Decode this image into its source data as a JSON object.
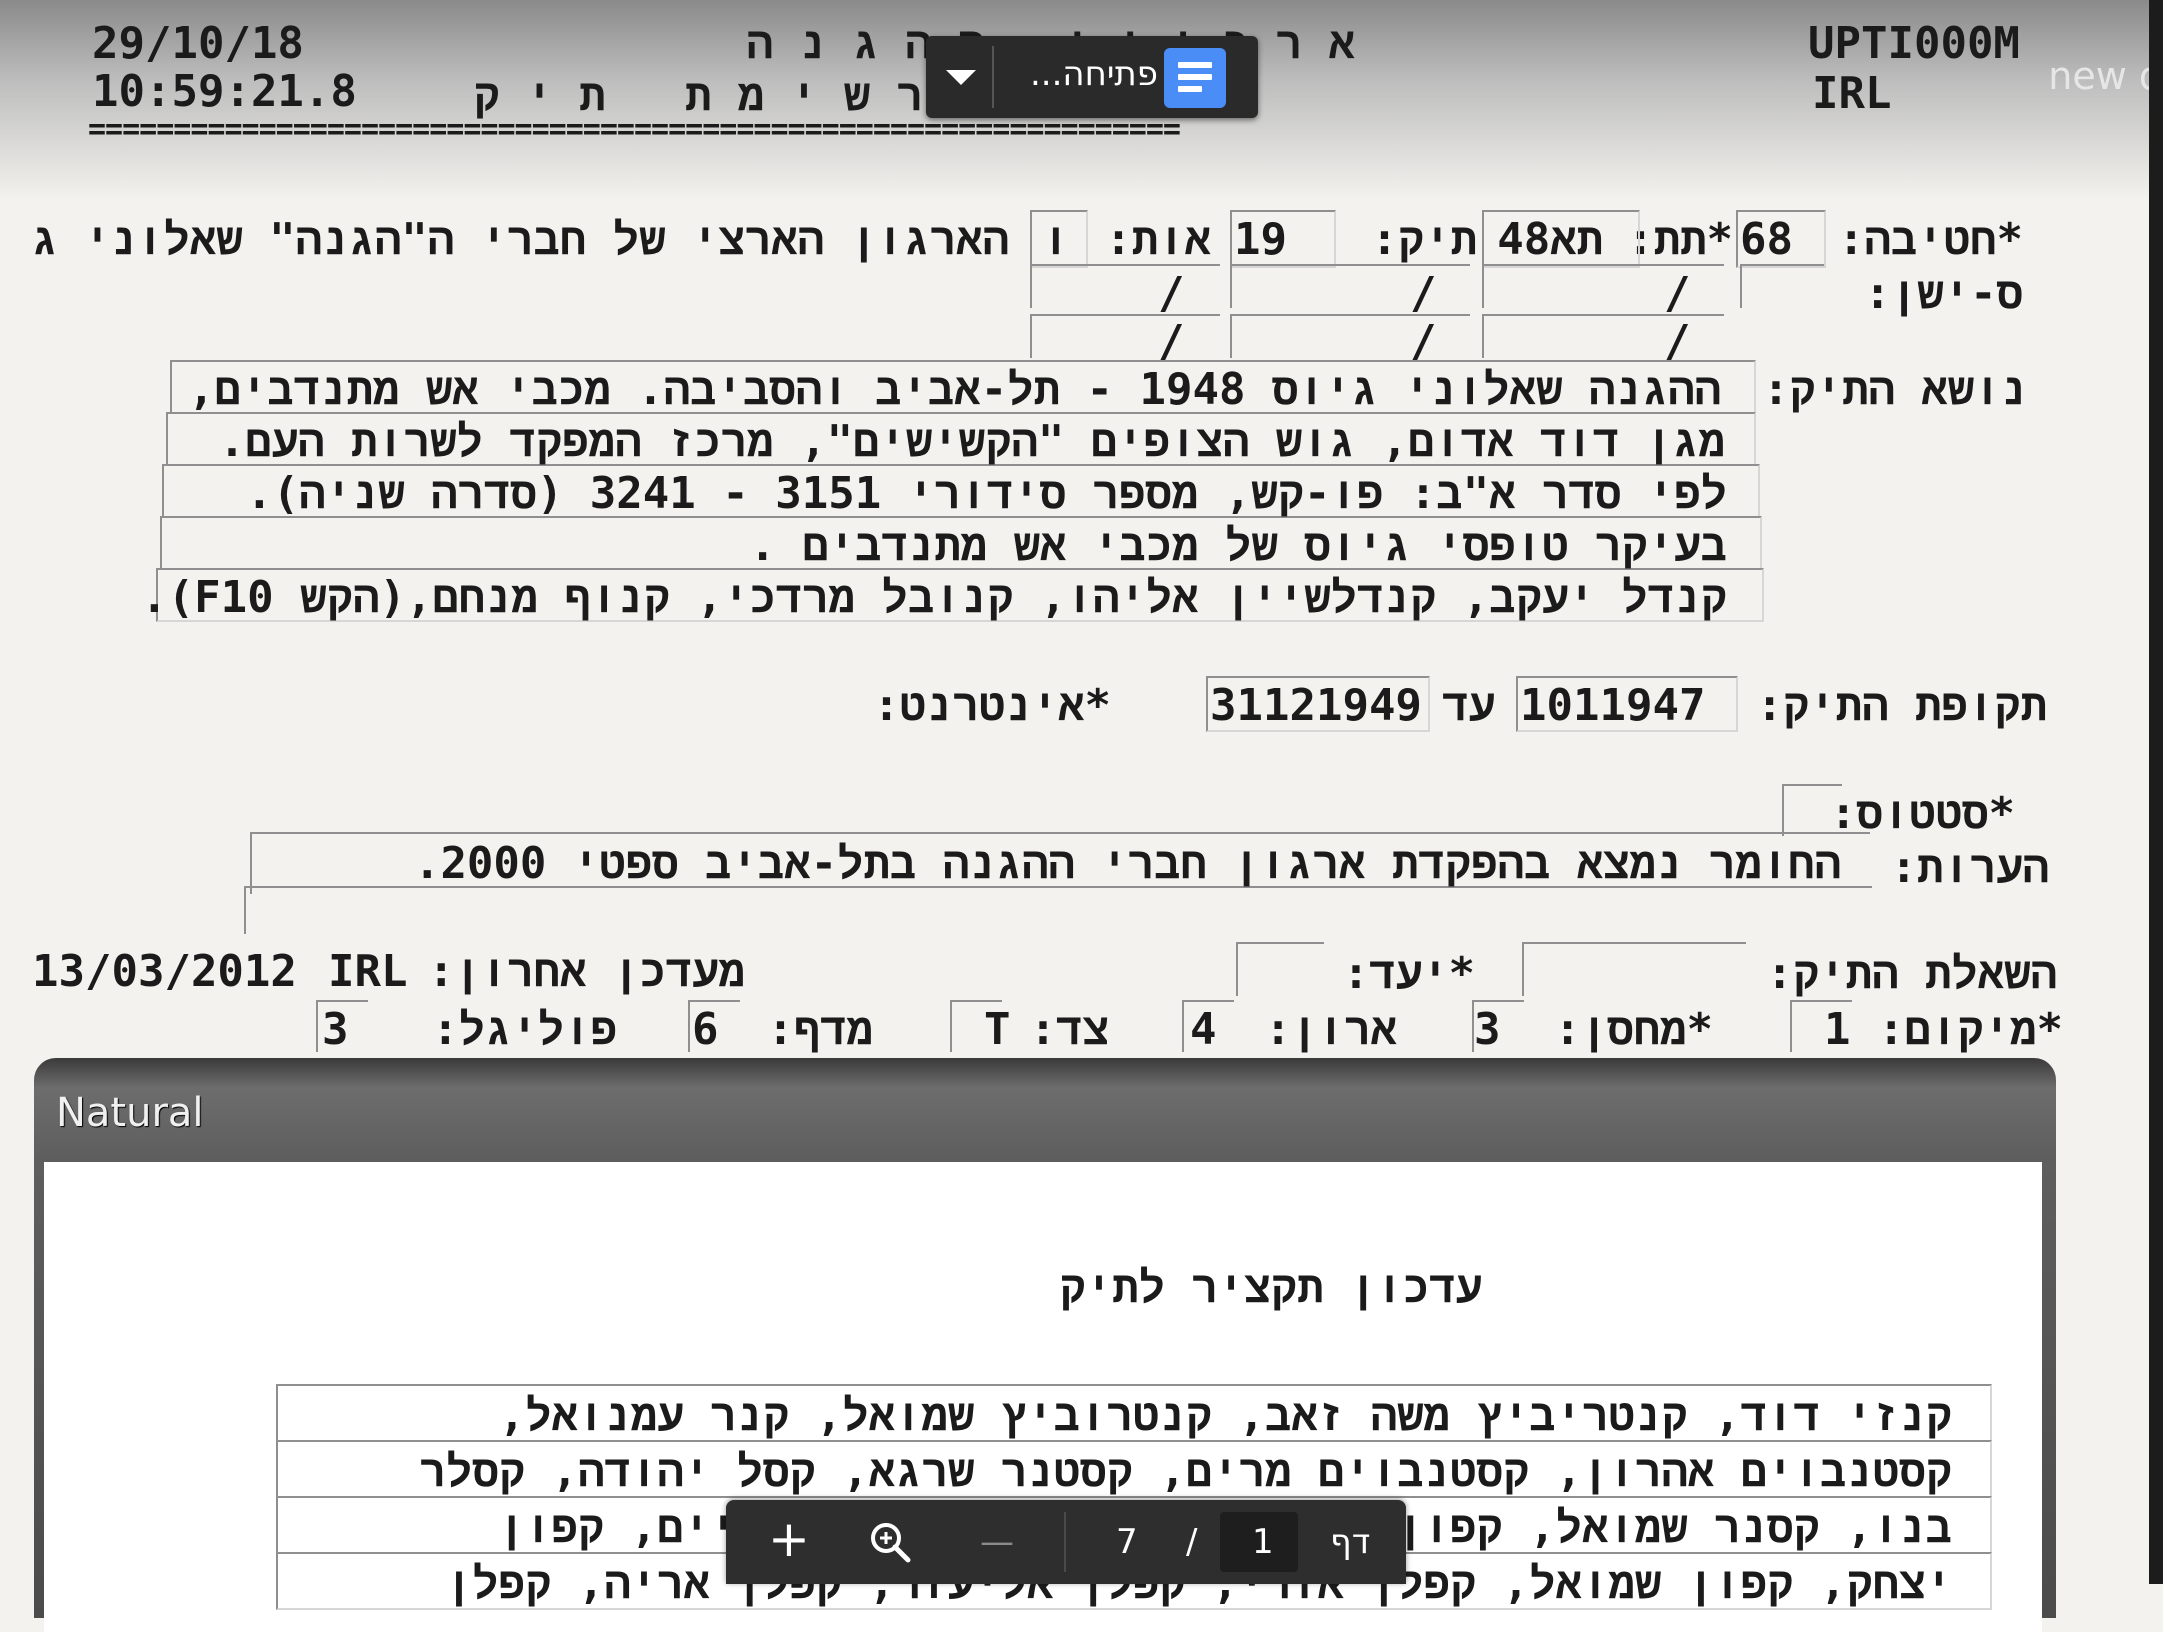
{
  "header": {
    "date": "29/10/18",
    "time": "10:59:21.8",
    "title_line1": "א ר כ י ו ן   ה ה ג נ ה",
    "title_line2": "ר ש י מ ת   ת י ק",
    "system_code": "UPTI000M",
    "user": "IRL",
    "separator": "================================================================"
  },
  "toolbar": {
    "open_label": "פתיחה...",
    "doc_icon": "google-docs-icon",
    "dropdown_icon": "caret-down-icon"
  },
  "new_tab_fragment": "new d",
  "record": {
    "brigade_label": "*חטיבה:",
    "brigade_value": "68",
    "sub_label": "*תת:",
    "sub_value": "תא48",
    "file_label": "תיק:",
    "file_value": "19",
    "letter_label": "אות:",
    "letter_value": "ו",
    "org_name": "הארגון הארצי של חברי ה\"הגנה\" שאלוני ג",
    "old_sig_label": "ס-ישן:",
    "slash": "/",
    "subject_label": "נושא התיק:",
    "subject_lines": [
      "ההגנה שאלוני גיוס 1948 - תל-אביב והסביבה. מכבי אש מתנדבים,",
      "מגן דוד אדום, גוש הצופים \"הקשישים\", מרכז המפקד לשרות העם.",
      "לפי סדר א\"ב: פו-קש, מספר סידורי 3151 - 3241 (סדרה שניה).",
      "בעיקר טופסי גיוס של מכבי אש מתנדבים .",
      "קנדל יעקב, קנדלשיין אליהו, קנובל מרדכי, קנוף מנחם,(הקש F10)."
    ],
    "period_label": "תקופת התיק:",
    "period_from": "1011947",
    "period_to_label": "עד",
    "period_to": "31121949",
    "internet_label": "*אינטרנט:",
    "status_label": "*סטטוס:",
    "notes_label": "הערות:",
    "notes_value": "החומר נמצא בהפקדת ארגון חברי ההגנה בתל-אביב ספטי 2000.",
    "loan_label": "השאלת התיק:",
    "dest_label": "*יעד:",
    "last_update_label": "מעדכן אחרון:",
    "last_update_user": "IRL",
    "last_update_date": "13/03/2012",
    "location_label": "*מיקום:",
    "location_value": "1",
    "warehouse_label": "*מחסן:",
    "warehouse_value": "3",
    "cabinet_label": "ארון:",
    "cabinet_value": "4",
    "side_label": "צד:",
    "side_value": "T",
    "shelf_label": "מדף:",
    "shelf_value": "6",
    "folio_label": "פוליגל:",
    "folio_value": "3"
  },
  "natural": {
    "window_title": "Natural",
    "heading": "עדכון תקציר לתיק",
    "lines": [
      "קנזי דוד, קנטריביץ משה זאב, קנטרוביץ שמואל, קנר עמנואל,",
      "קסטנבוים אהרון, קסטנבוים מרים, קסטנר שרגא, קסל יהודה, קסלר",
      "בנו, קסנר שמואל, קפון אליהו, קפון דורה, קפון חיים, קפון",
      "יצחק, קפון שמואל, קפלן אורי, קפלן אליעזר, קפלן אריה, קפלן"
    ]
  },
  "pager": {
    "page_label": "דף",
    "current_page": "1",
    "divider": "/",
    "total_pages": "7",
    "zoom_out": "—",
    "zoom_icon": "zoom-in-icon",
    "plus": "+"
  }
}
